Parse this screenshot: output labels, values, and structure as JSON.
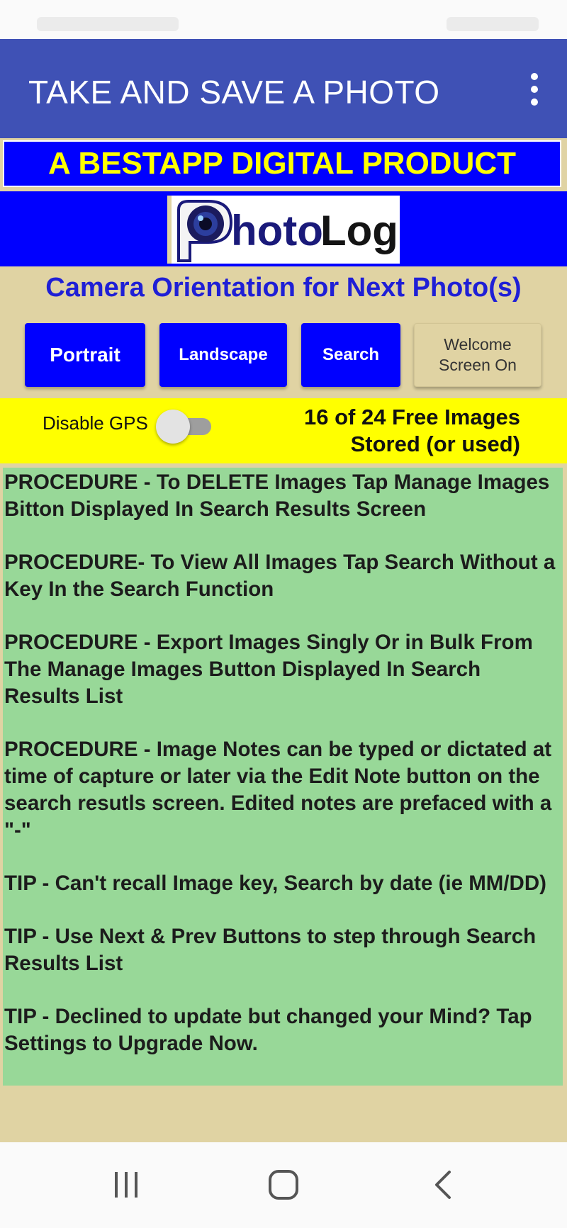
{
  "app_bar": {
    "title": "TAKE AND SAVE A PHOTO",
    "menu_icon": "more-vert-icon",
    "background": "#3f51b5"
  },
  "banner": {
    "text": "A BESTAPP DIGITAL PRODUCT",
    "text_color": "#ffff00",
    "background": "#0000ff"
  },
  "logo": {
    "text_left": "hoto",
    "text_right": "Log",
    "icon": "camera-lens-icon"
  },
  "orientation": {
    "title": "Camera Orientation for Next Photo(s)"
  },
  "buttons": {
    "portrait": "Portrait",
    "landscape": "Landscape",
    "search": "Search",
    "welcome_line1": "Welcome",
    "welcome_line2": "Screen On"
  },
  "gps": {
    "label": "Disable GPS",
    "enabled": false
  },
  "image_count": {
    "line1": "16 of 24 Free Images",
    "line2": "Stored (or used)"
  },
  "tips": [
    "PROCEDURE - To DELETE Images Tap Manage Images Bitton Displayed In Search Results Screen",
    "PROCEDURE- To View All Images Tap Search Without a Key In the Search Function",
    "PROCEDURE - Export Images Singly Or in Bulk From The Manage Images Button Displayed In Search Results List",
    "PROCEDURE - Image Notes can be typed or dictated at time of capture or later via the Edit Note button on the search resutls screen. Edited notes are prefaced with a \"-\"",
    "TIP - Can't recall Image key, Search by date (ie MM/DD)",
    "TIP - Use Next & Prev Buttons to step through Search Results List",
    "TIP - Declined to update but changed your Mind? Tap Settings to Upgrade Now."
  ],
  "nav": {
    "recents_icon": "recent-apps-icon",
    "home_icon": "home-icon",
    "back_icon": "back-icon"
  },
  "colors": {
    "page_background": "#e0d3a3",
    "tips_background": "#98d898",
    "gps_bar": "#ffff00",
    "button_blue": "#0000ff",
    "orientation_title": "#1f1fd6"
  }
}
